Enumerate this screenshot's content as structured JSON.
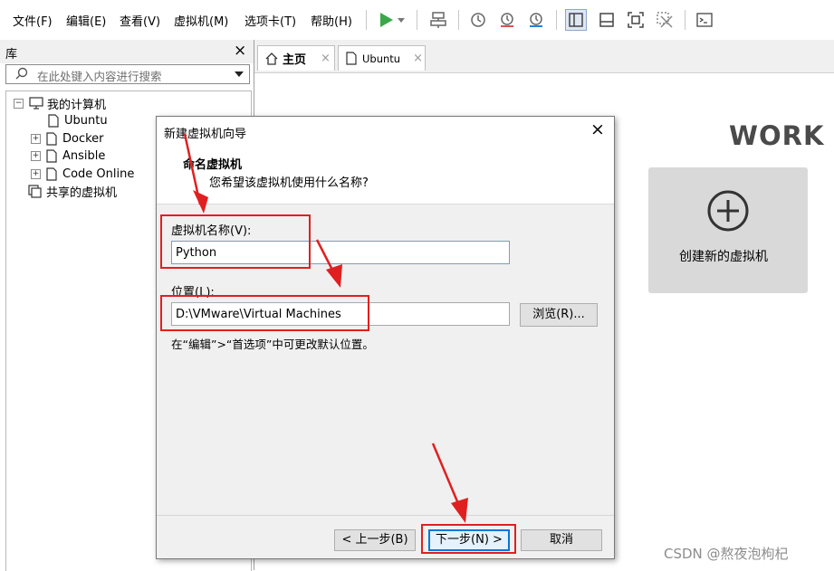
{
  "menubar": {
    "items": [
      "文件(F)",
      "编辑(E)",
      "查看(V)",
      "虚拟机(M)",
      "选项卡(T)",
      "帮助(H)"
    ],
    "toolbar_icons": [
      "play-icon",
      "dropdown-arrow-icon",
      "network-icon",
      "snapshot-icon",
      "revert-snapshot-icon",
      "snapshot-manager-icon",
      "sidebar-toggle-icon",
      "console-view-icon",
      "fullscreen-icon",
      "unity-icon",
      "terminal-icon"
    ]
  },
  "library": {
    "title": "库",
    "close": "×",
    "search_placeholder": "在此处键入内容进行搜索",
    "tree": [
      {
        "label": "我的计算机",
        "expander": "⊟",
        "icon": "computer-icon"
      },
      {
        "label": "Ubuntu",
        "icon": "vm-icon"
      },
      {
        "label": "Docker",
        "expander": "⊞",
        "icon": "vm-icon"
      },
      {
        "label": "Ansible",
        "expander": "⊞",
        "icon": "vm-icon"
      },
      {
        "label": "Code Online",
        "expander": "⊞",
        "icon": "vm-icon"
      },
      {
        "label": "共享的虚拟机",
        "icon": "shared-vm-icon"
      }
    ]
  },
  "tabs": [
    {
      "label": "主页",
      "close": "×"
    },
    {
      "label": "Ubuntu",
      "close": "×"
    }
  ],
  "home": {
    "title": "WORK",
    "create_label": "创建新的虚拟机"
  },
  "dialog": {
    "title": "新建虚拟机向导",
    "close": "×",
    "heading": "命名虚拟机",
    "subheading": "您希望该虚拟机使用什么名称?",
    "name_label": "虚拟机名称(V):",
    "name_value": "Python",
    "location_label": "位置(L):",
    "location_value": "D:\\VMware\\Virtual Machines",
    "browse_label": "浏览(R)...",
    "hint": "在“编辑”>“首选项”中可更改默认位置。",
    "back_label": "< 上一步(B)",
    "next_label": "下一步(N) >",
    "cancel_label": "取消"
  },
  "watermark": "CSDN @熬夜泡枸杞",
  "colors": {
    "accent_green": "#3aa84a",
    "annotation_red": "#e02020",
    "focus_blue": "#0078d7"
  }
}
